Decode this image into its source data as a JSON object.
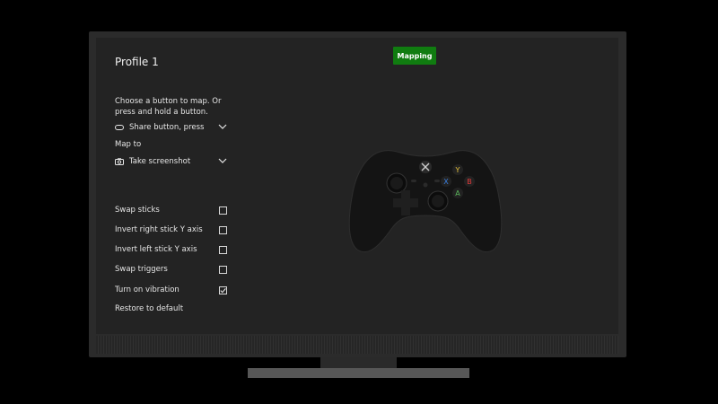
{
  "profile": {
    "title": "Profile 1"
  },
  "mapping_button": {
    "label": "Mapping"
  },
  "instruction": "Choose a button to map. Or press and hold a button.",
  "button_select": {
    "value": "Share button, press",
    "icon": "share-button-icon"
  },
  "map_to": {
    "label": "Map to",
    "value": "Take screenshot",
    "icon": "camera-icon"
  },
  "options": [
    {
      "label": "Swap sticks",
      "checked": false
    },
    {
      "label": "Invert right stick Y axis",
      "checked": false
    },
    {
      "label": "Invert left stick Y axis",
      "checked": false
    },
    {
      "label": "Swap triggers",
      "checked": false
    },
    {
      "label": "Turn on vibration",
      "checked": true
    }
  ],
  "restore": {
    "label": "Restore to default"
  },
  "face_buttons": {
    "Y": "Y",
    "X": "X",
    "B": "B",
    "A": "A"
  },
  "colors": {
    "accent_green": "#107c10",
    "button_a": "#5bb85b",
    "button_b": "#e23a3a",
    "button_x": "#3a7fe0",
    "button_y": "#e8c23a"
  }
}
